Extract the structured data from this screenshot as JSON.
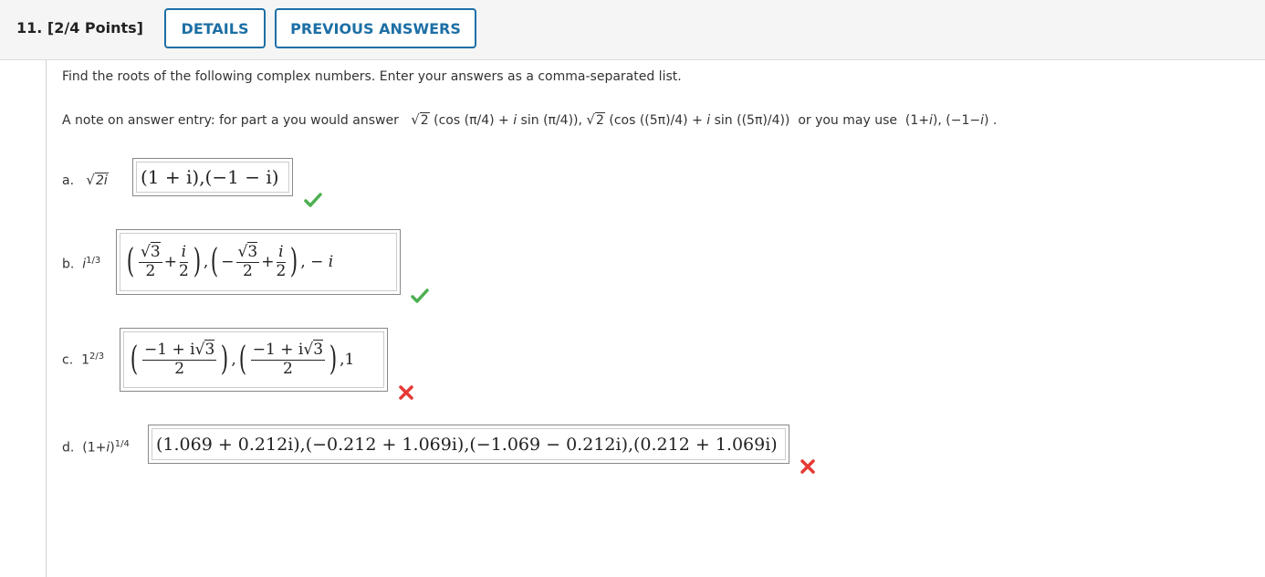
{
  "header": {
    "question_number": "11.",
    "points": "[2/4 Points]",
    "details_label": "DETAILS",
    "previous_answers_label": "PREVIOUS ANSWERS"
  },
  "instructions": "Find the roots of the following complex numbers. Enter your answers as a comma-separated list.",
  "note": {
    "prefix": "A note on answer entry: for part a you would answer",
    "root": "2",
    "term1": "(cos (π/4) + ",
    "i1": "i",
    "term1b": " sin (π/4)),",
    "term2": "(cos ((5π)/4) + ",
    "i2": "i",
    "term2b": " sin ((5π)/4))",
    "or_text": "or you may use",
    "alt": "(1+",
    "alt_i": "i",
    "alt2": "), (−1−",
    "alt_i2": "i",
    "alt3": ") ."
  },
  "parts": {
    "a": {
      "label": "a.",
      "expr_root": "2i",
      "answer": "(1 + i),(−1 − i)",
      "status": "correct"
    },
    "b": {
      "label": "b.",
      "expr_base": "i",
      "expr_exp": "1/3",
      "status": "correct"
    },
    "c": {
      "label": "c.",
      "expr_base": "1",
      "expr_exp": "2/3",
      "status": "incorrect"
    },
    "d": {
      "label": "d.",
      "expr_base": "(1+",
      "expr_i": "i",
      "expr_close": ")",
      "expr_exp": "1/4",
      "answer": "(1.069 + 0.212i),(−0.212 + 1.069i),(−1.069 − 0.212i),(0.212 + 1.069i)",
      "status": "incorrect"
    }
  },
  "math": {
    "sqrt3": "3",
    "two": "2",
    "i": "i",
    "plus": "+",
    "minus": "−",
    "neg_one_plus_i": "−1 + i",
    "comma": ",",
    "minus_i": "− i",
    "comma_one": ",1"
  },
  "colors": {
    "accent": "#1d6fa5",
    "correct": "#4caf50",
    "incorrect": "#e53935"
  }
}
